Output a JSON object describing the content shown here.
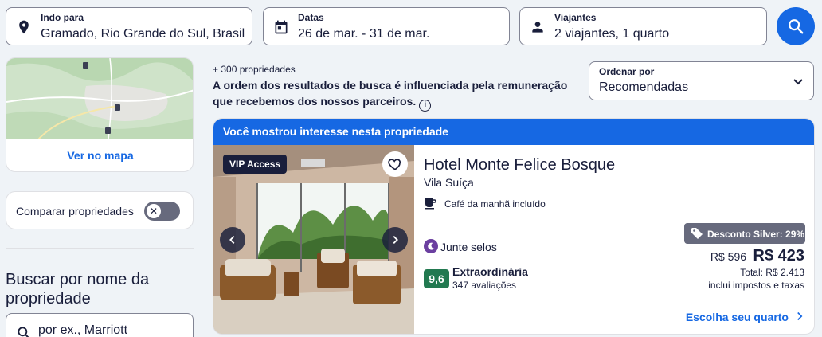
{
  "search": {
    "destination": {
      "label": "Indo para",
      "value": "Gramado, Rio Grande do Sul, Brasil",
      "icon": "location-pin-icon"
    },
    "dates": {
      "label": "Datas",
      "value": "26 de mar. - 31 de mar.",
      "icon": "calendar-icon"
    },
    "travelers": {
      "label": "Viajantes",
      "value": "2 viajantes, 1 quarto",
      "icon": "person-icon"
    },
    "button_icon": "search-icon"
  },
  "sidebar": {
    "map_link": "Ver no mapa",
    "compare_label": "Comparar propriedades",
    "compare_enabled": false,
    "name_search_title": "Buscar por nome da propriedade",
    "name_search_placeholder": "por ex., Marriott"
  },
  "results": {
    "count": "+ 300 propriedades",
    "notice": "A ordem dos resultados de busca é influenciada pela remuneração que recebemos dos nossos parceiros.",
    "sort": {
      "label": "Ordenar por",
      "value": "Recomendadas"
    }
  },
  "listing": {
    "banner": "Você mostrou interesse nesta propriedade",
    "badge": "VIP Access",
    "name": "Hotel Monte Felice Bosque",
    "neighborhood": "Vila Suíça",
    "amenity": "Café da manhã incluído",
    "loyalty": "Junte selos",
    "rating_score": "9,6",
    "rating_label": "Extraordinária",
    "rating_count": "347 avaliações",
    "discount": "Desconto Silver: 29%",
    "old_price": "R$ 596",
    "price": "R$ 423",
    "total": "Total: R$ 2.413",
    "taxes": "inclui impostos e taxas",
    "cta": "Escolha seu quarto"
  },
  "colors": {
    "accent": "#1668e3",
    "rating": "#227950",
    "dark": "#191e3b",
    "loyalty": "#6b3fa0"
  }
}
